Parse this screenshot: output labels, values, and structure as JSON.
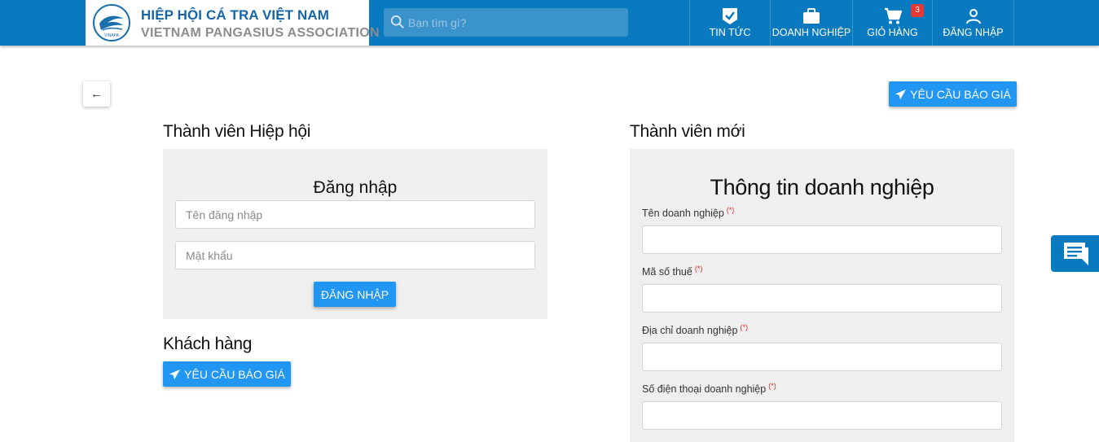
{
  "header": {
    "logo": {
      "title": "HIỆP HỘI CÁ TRA VIỆT NAM",
      "subtitle": "VIETNAM PANGASIUS ASSOCIATION",
      "emblem_text": "VINAPA"
    },
    "search": {
      "placeholder": "Bạn tìm gì?",
      "value": ""
    },
    "nav": [
      {
        "label": "TIN TỨC",
        "icon": "news-check-icon"
      },
      {
        "label": "DOANH NGHIỆP",
        "icon": "briefcase-icon"
      },
      {
        "label": "GIỎ HÀNG",
        "icon": "cart-icon",
        "badge": "3"
      },
      {
        "label": "ĐĂNG NHẬP",
        "icon": "user-icon"
      }
    ],
    "colors": {
      "header_bg": "#0a7ac0",
      "accent": "#2196f3",
      "badge": "#e53935"
    }
  },
  "toolbar": {
    "back_label": "←",
    "quote_label": "YÊU CẦU BÁO GIÁ"
  },
  "member": {
    "title": "Thành viên Hiệp hội",
    "login": {
      "heading": "Đăng nhập",
      "username_placeholder": "Tên đăng nhập",
      "password_placeholder": "Mật khẩu",
      "submit_label": "ĐĂNG NHẬP"
    }
  },
  "customer": {
    "title": "Khách hàng",
    "quote_label": "YÊU CẦU BÁO GIÁ"
  },
  "new_member": {
    "title": "Thành viên mới",
    "form_heading": "Thông tin doanh nghiệp",
    "required_mark": "(*)",
    "fields": [
      {
        "label": "Tên doanh nghiệp",
        "value": ""
      },
      {
        "label": "Mã số thuế",
        "value": ""
      },
      {
        "label": "Địa chỉ doanh nghiệp",
        "value": ""
      },
      {
        "label": "Số điện thoại doanh nghiệp",
        "value": ""
      }
    ]
  },
  "chat": {
    "icon": "chat-icon"
  }
}
